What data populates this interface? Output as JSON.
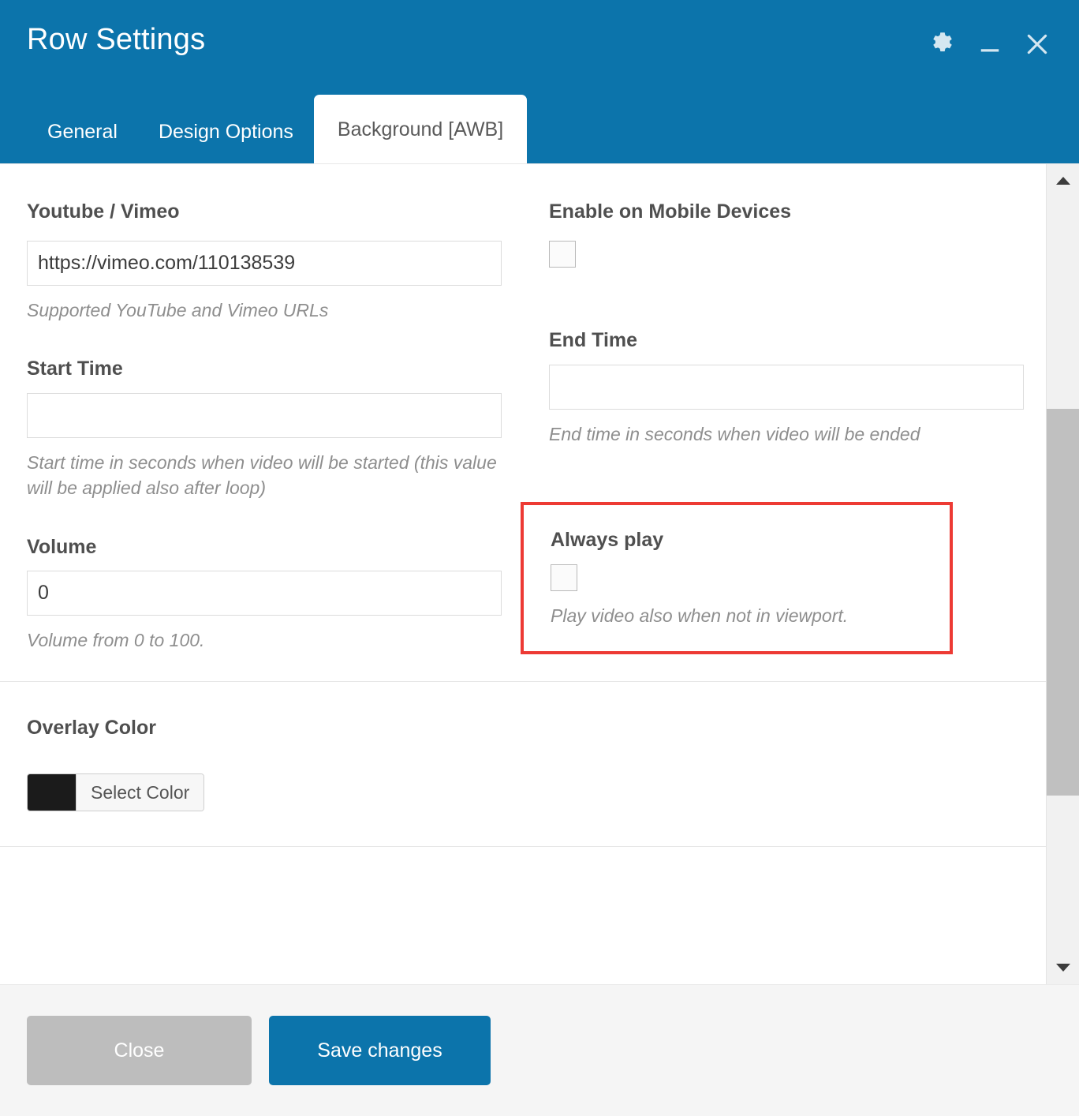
{
  "window": {
    "title": "Row Settings",
    "accent_color": "#0c74ab",
    "controls": [
      {
        "name": "gear-icon",
        "label": "Settings"
      },
      {
        "name": "minimize-icon",
        "label": "Minimize"
      },
      {
        "name": "close-icon",
        "label": "Close"
      }
    ]
  },
  "tabs": [
    {
      "label": "General",
      "active": false
    },
    {
      "label": "Design Options",
      "active": false
    },
    {
      "label": "Background [AWB]",
      "active": true
    }
  ],
  "form": {
    "video_url": {
      "label": "Youtube / Vimeo",
      "value": "https://vimeo.com/110138539",
      "placeholder": "",
      "help": "Supported YouTube and Vimeo URLs"
    },
    "enable_mobile": {
      "label": "Enable on Mobile Devices",
      "checked": false
    },
    "start_time": {
      "label": "Start Time",
      "value": "",
      "placeholder": "",
      "help": "Start time in seconds when video will be started (this value will be applied also after loop)"
    },
    "end_time": {
      "label": "End Time",
      "value": "",
      "placeholder": "",
      "help": "End time in seconds when video will be ended"
    },
    "volume": {
      "label": "Volume",
      "value": "0",
      "placeholder": "",
      "help": "Volume from 0 to 100."
    },
    "always_play": {
      "label": "Always play",
      "checked": false,
      "help": "Play video also when not in viewport.",
      "highlight_color": "#ed3a34"
    },
    "overlay_color": {
      "label": "Overlay Color",
      "button_label": "Select Color",
      "swatch_color": "#1b1b1b"
    }
  },
  "footer": {
    "close_label": "Close",
    "save_label": "Save changes"
  }
}
